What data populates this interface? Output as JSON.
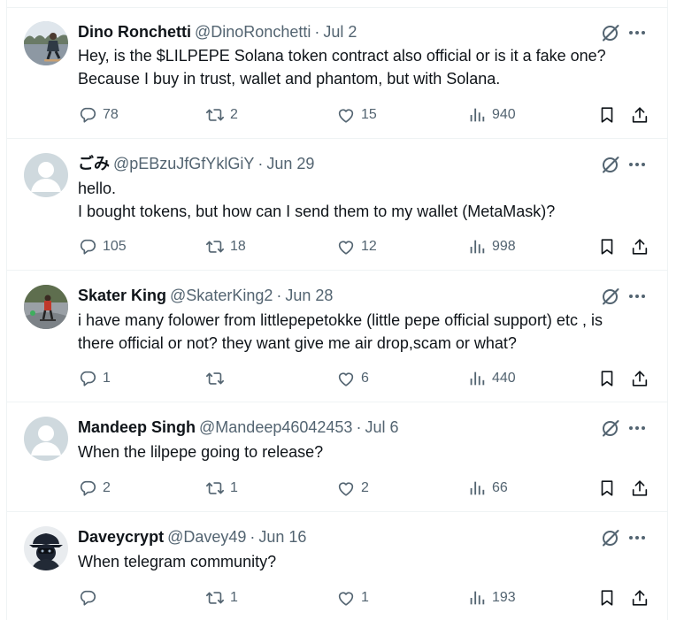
{
  "colors": {
    "text": "#0f1419",
    "muted": "#536471",
    "border": "#eff3f4",
    "avatar_placeholder": "#cfd9de"
  },
  "tweets": [
    {
      "name": "Dino Ronchetti",
      "handle": "@DinoRonchetti",
      "dot": "·",
      "date": "Jul 2",
      "avatar": "photo-skateboarder",
      "lines": [
        "Hey, is the $LILPEPE Solana token contract also official or is it a fake one?",
        "Because I buy in trust, wallet and phantom, but with Solana."
      ],
      "replies": "78",
      "retweets": "2",
      "likes": "15",
      "views": "940"
    },
    {
      "name": "ごみ",
      "handle": "@pEBzuJfGfYklGiY",
      "dot": "·",
      "date": "Jun 29",
      "avatar": "default-avatar",
      "lines": [
        "hello.",
        "I bought tokens, but how can I send them to my wallet (MetaMask)?"
      ],
      "replies": "105",
      "retweets": "18",
      "likes": "12",
      "views": "998"
    },
    {
      "name": "Skater King",
      "handle": "@SkaterKing2",
      "dot": "·",
      "date": "Jun 28",
      "avatar": "photo-skatepark",
      "lines": [
        "i have many folower from littlepepetokke (little pepe official support) etc , is",
        "there official or not? they want give me air drop,scam or what?"
      ],
      "replies": "1",
      "retweets": "",
      "likes": "6",
      "views": "440"
    },
    {
      "name": "Mandeep Singh",
      "handle": "@Mandeep46042453",
      "dot": "·",
      "date": "Jul 6",
      "avatar": "default-avatar",
      "lines": [
        "When the lilpepe going to release?"
      ],
      "replies": "2",
      "retweets": "1",
      "likes": "2",
      "views": "66"
    },
    {
      "name": "Daveycrypt",
      "handle": "@Davey49",
      "dot": "·",
      "date": "Jun 16",
      "avatar": "masked-figure",
      "lines": [
        "When telegram community?"
      ],
      "replies": "",
      "retweets": "1",
      "likes": "1",
      "views": "193"
    }
  ]
}
